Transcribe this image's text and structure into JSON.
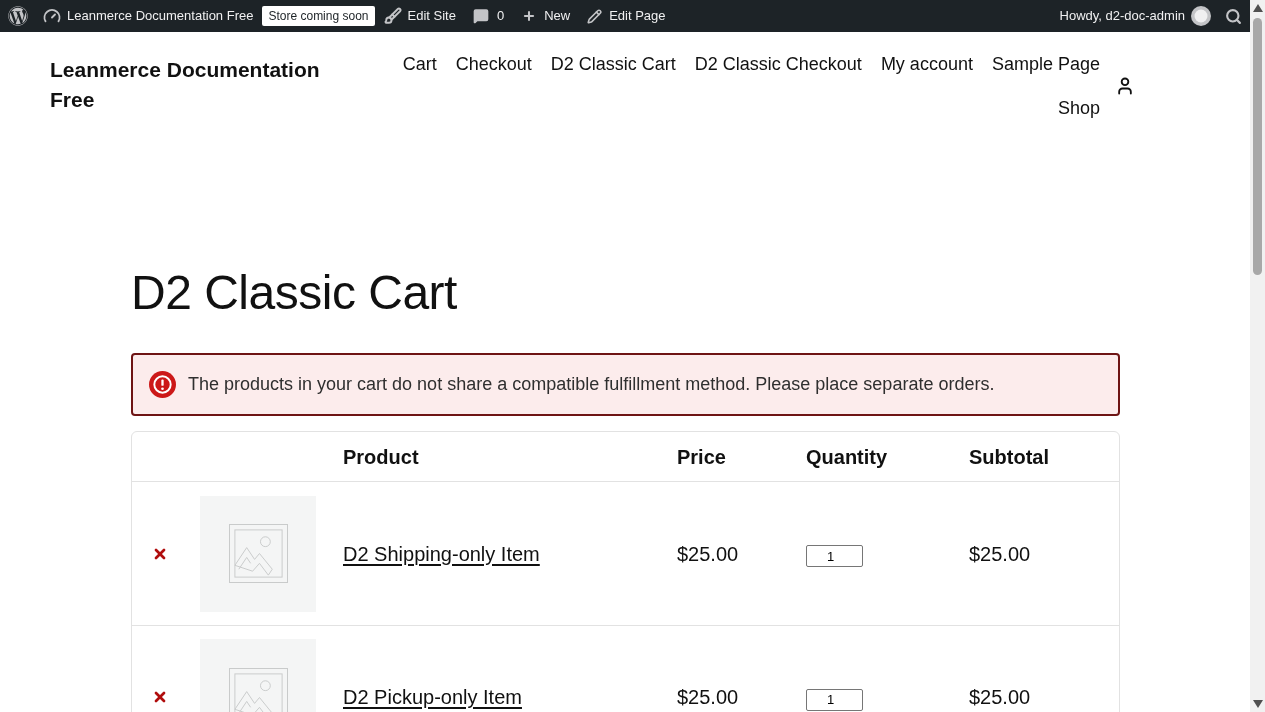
{
  "admin_bar": {
    "site_name": "Leanmerce Documentation Free",
    "badge": "Store coming soon",
    "edit_site": "Edit Site",
    "comments": "0",
    "new": "New",
    "edit_page": "Edit Page",
    "greeting": "Howdy, d2-doc-admin"
  },
  "header": {
    "site_title": "Leanmerce Documentation Free",
    "nav": [
      "Cart",
      "Checkout",
      "D2 Classic Cart",
      "D2 Classic Checkout",
      "My account",
      "Sample Page",
      "Shop"
    ]
  },
  "page_title": "D2 Classic Cart",
  "notice": {
    "kind": "error",
    "message": "The products in your cart do not share a compatible fulfillment method. Please place separate orders."
  },
  "cart_table": {
    "columns": [
      "Product",
      "Price",
      "Quantity",
      "Subtotal"
    ],
    "rows": [
      {
        "product": "D2 Shipping-only Item",
        "price": "$25.00",
        "quantity": "1",
        "subtotal": "$25.00"
      },
      {
        "product": "D2 Pickup-only Item",
        "price": "$25.00",
        "quantity": "1",
        "subtotal": "$25.00"
      }
    ]
  }
}
